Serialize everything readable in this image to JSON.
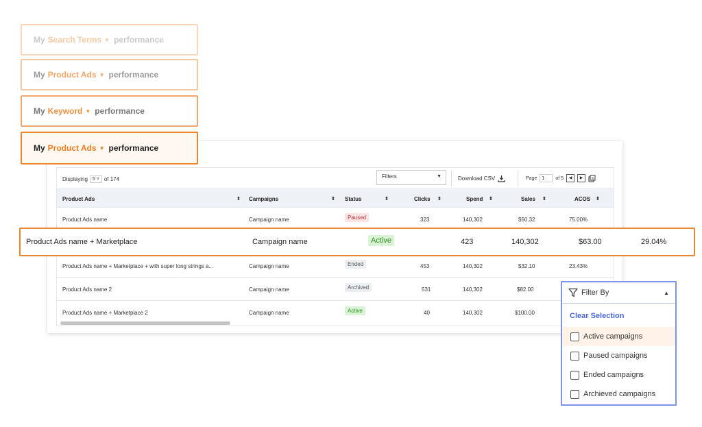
{
  "performance_selectors": [
    {
      "prefix": "My",
      "type": "Search Terms",
      "suffix": "performance"
    },
    {
      "prefix": "My",
      "type": "Product Ads",
      "suffix": "performance"
    },
    {
      "prefix": "My",
      "type": "Keyword",
      "suffix": "performance"
    },
    {
      "prefix": "My",
      "type": "Product Ads",
      "suffix": "performance"
    }
  ],
  "toolbar": {
    "displaying_label": "Displaying",
    "per_page": "5",
    "of_total": "of 174",
    "filters_label": "Filters",
    "download_label": "Download CSV",
    "page_label": "Page",
    "page_value": "1",
    "of_pages": "of 5"
  },
  "columns": [
    "Product Ads",
    "Campaigns",
    "Status",
    "Clicks",
    "Spend",
    "Sales",
    "ACOS"
  ],
  "rows": [
    {
      "product": "Product Ads name",
      "campaign": "Campaign name",
      "status": "Paused",
      "clicks": "323",
      "spend": "140,302",
      "sales": "$50.32",
      "acos": "75.00%"
    },
    {
      "product": "Product Ads name + Marketplace + with super long strings a...",
      "campaign": "Campaign name",
      "status": "Ended",
      "clicks": "453",
      "spend": "140,302",
      "sales": "$32.10",
      "acos": "23.43%"
    },
    {
      "product": "Product Ads name 2",
      "campaign": "Campaign name",
      "status": "Archived",
      "clicks": "531",
      "spend": "140,302",
      "sales": "$82.00",
      "acos": ""
    },
    {
      "product": "Product Ads name + Marketplace 2",
      "campaign": "Campaign name",
      "status": "Active",
      "clicks": "40",
      "spend": "140,302",
      "sales": "$100.00",
      "acos": ""
    }
  ],
  "highlighted_row": {
    "product": "Product Ads name + Marketplace",
    "campaign": "Campaign name",
    "status": "Active",
    "clicks": "423",
    "spend": "140,302",
    "sales": "$63.00",
    "acos": "29.04%"
  },
  "filter_popup": {
    "title": "Filter By",
    "clear_label": "Clear Selection",
    "options": [
      "Active campaigns",
      "Paused campaigns",
      "Ended campaigns",
      "Archieved campaigns"
    ]
  },
  "colors": {
    "accent": "#e8852f",
    "filter_border": "#7f93e8",
    "link": "#4a66d8"
  }
}
